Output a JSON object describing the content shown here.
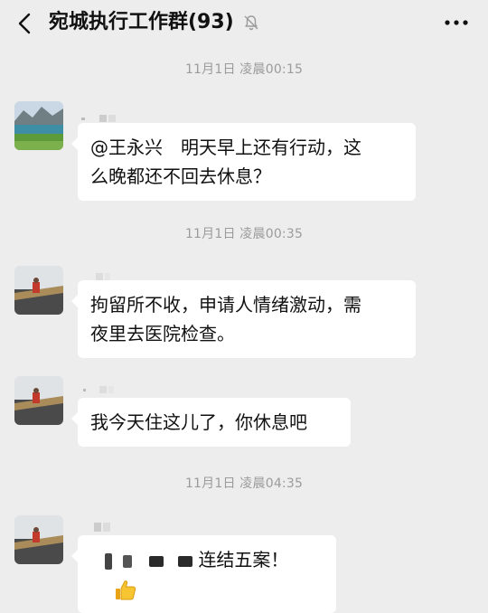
{
  "header": {
    "title": "宛城执行工作群(93)"
  },
  "timestamps": [
    "11月1日 凌晨00:15",
    "11月1日 凌晨00:35",
    "11月1日 凌晨04:35"
  ],
  "messages": [
    {
      "line1": "@王永兴　明天早上还有行动，这",
      "line2": "么晚都还不回去休息？"
    },
    {
      "line1": "拘留所不收，申请人情绪激动，需",
      "line2": "夜里去医院检查。"
    },
    {
      "line1": "我今天住这儿了，你休息吧"
    },
    {
      "text": "连结五案！",
      "emoji": "thumbs-up"
    }
  ],
  "colors": {
    "background": "#ededed",
    "bubble": "#ffffff",
    "timestamp": "#9b9b9b",
    "text": "#111111"
  }
}
